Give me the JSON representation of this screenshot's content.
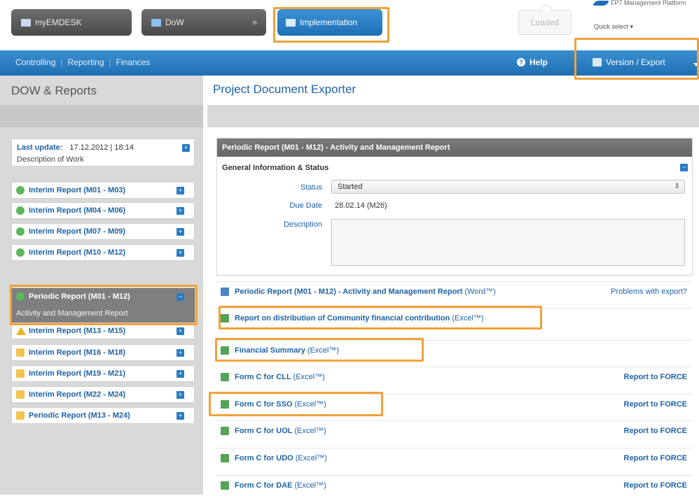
{
  "top": {
    "tabs": [
      {
        "label": "myEMDESK"
      },
      {
        "label": "DoW"
      },
      {
        "label": "Implementation"
      }
    ],
    "crumb_separator": "»",
    "loaded_label": "Loaded",
    "platform_name": "FP7 Management Platform",
    "quick_select": "Quick select ▾"
  },
  "nav": {
    "links": [
      {
        "label": "Controlling"
      },
      {
        "label": "Reporting"
      },
      {
        "label": "Finances"
      }
    ],
    "separator": "|",
    "help_label": "Help",
    "help_icon_glyph": "?",
    "version_label": "Version / Export"
  },
  "sidebar": {
    "title": "DOW & Reports",
    "last_update_label": "Last update:",
    "last_update_value": "17.12.2012 | 18:14",
    "description": "Description of Work",
    "expand_glyph": "+",
    "collapse_glyph": "−",
    "reports": [
      {
        "name": "Interim Report",
        "period": "(M01 - M03)",
        "status": "ok"
      },
      {
        "name": "Interim Report",
        "period": "(M04 - M06)",
        "status": "ok"
      },
      {
        "name": "Interim Report",
        "period": "(M07 - M09)",
        "status": "ok"
      },
      {
        "name": "Interim Report",
        "period": "(M10 - M12)",
        "status": "ok"
      },
      {
        "name": "Periodic Report",
        "period": "(M01 - M12)",
        "status": "ok",
        "active": true,
        "sub": "Activity and Management Report"
      },
      {
        "name": "Interim Report",
        "period": "(M13 - M15)",
        "status": "warn"
      },
      {
        "name": "Interim Report",
        "period": "(M16 - M18)",
        "status": "lock"
      },
      {
        "name": "Interim Report",
        "period": "(M19 - M21)",
        "status": "lock"
      },
      {
        "name": "Interim Report",
        "period": "(M22 - M24)",
        "status": "lock"
      },
      {
        "name": "Periodic Report",
        "period": "(M13 - M24)",
        "status": "lock"
      }
    ]
  },
  "main": {
    "title": "Project Document Exporter",
    "panel": {
      "header": "Periodic Report (M01 - M12) - Activity and Management Report",
      "section": "General Information & Status",
      "status_label": "Status",
      "status_value": "Started",
      "select_arrow": "⇕",
      "due_label": "Due Date",
      "due_value": "28.02.14 (M26)",
      "description_label": "Description",
      "description_value": ""
    },
    "exports": [
      {
        "name": "Periodic Report (M01 - M12) - Activity and Management Report",
        "format": "(Word™)",
        "type": "word",
        "action": "Problems with export?"
      },
      {
        "name": "Report on distribution of Community financial contribution",
        "format": "(Excel™)",
        "type": "excel",
        "action": ""
      },
      {
        "name": "Financial Summary",
        "format": "(Excel™)",
        "type": "excel",
        "action": ""
      },
      {
        "name": "Form C for CLL",
        "format": "(Excel™)",
        "type": "excel",
        "action": "Report to FORCE"
      },
      {
        "name": "Form C for SSO",
        "format": "(Excel™)",
        "type": "excel",
        "action": "Report to FORCE"
      },
      {
        "name": "Form C for UOL",
        "format": "(Excel™)",
        "type": "excel",
        "action": "Report to FORCE"
      },
      {
        "name": "Form C for UDO",
        "format": "(Excel™)",
        "type": "excel",
        "action": "Report to FORCE"
      },
      {
        "name": "Form C for DAE",
        "format": "(Excel™)",
        "type": "excel",
        "action": "Report to FORCE"
      }
    ]
  },
  "colors": {
    "accent": "#1e62a6",
    "nav_blue": "#2a7cc4",
    "highlight": "#f0a23a",
    "active_item": "#7f7f7f",
    "sidebar_bg": "#d9d9d9"
  }
}
